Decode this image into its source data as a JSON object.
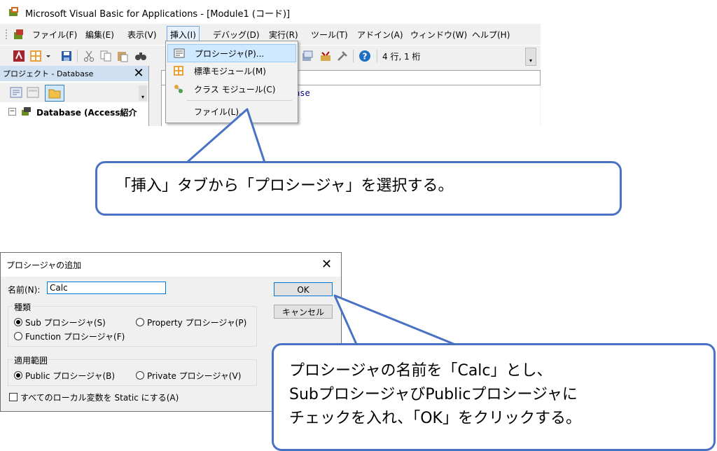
{
  "vba": {
    "title": "Microsoft Visual Basic for Applications - [Module1 (コード)]",
    "menus": [
      "ファイル(F)",
      "編集(E)",
      "表示(V)",
      "挿入(I)",
      "デバッグ(D)",
      "実行(R)",
      "ツール(T)",
      "アドイン(A)",
      "ウィンドウ(W)",
      "ヘルプ(H)"
    ],
    "active_menu": "挿入(I)",
    "position_status": "4 行, 1 桁",
    "project_title": "プロジェクト - Database",
    "project_close": "✕",
    "tree_root": "Database (Access紹介",
    "code_fragment": "ase"
  },
  "insert_menu": {
    "items": [
      {
        "label": "プロシージャ(P)...",
        "icon": "procedure-icon",
        "highlighted": true
      },
      {
        "label": "標準モジュール(M)",
        "icon": "module-icon"
      },
      {
        "label": "クラス モジュール(C)",
        "icon": "class-module-icon"
      },
      {
        "label": "ファイル(L)..."
      }
    ]
  },
  "callout1": {
    "text": "「挿入」タブから「プロシージャ」を選択する。"
  },
  "dialog": {
    "title": "プロシージャの追加",
    "close": "✕",
    "name_label": "名前(N):",
    "name_value": "Calc",
    "ok_label": "OK",
    "cancel_label": "キャンセル",
    "kind_group": "種類",
    "kind_sub": "Sub プロシージャ(S)",
    "kind_property": "Property プロシージャ(P)",
    "kind_function": "Function プロシージャ(F)",
    "scope_group": "適用範囲",
    "scope_public": "Public プロシージャ(B)",
    "scope_private": "Private プロシージャ(V)",
    "static_label": "すべてのローカル変数を Static にする(A)"
  },
  "callout2": {
    "lines": [
      "プロシージャの名前を「Calc」とし、",
      "SubプロシージャびPublicプロシージャに",
      "チェックを入れ、「OK」をクリックする。"
    ]
  },
  "colors": {
    "callout_border": "#4a72c4",
    "highlight": "#cde8ff"
  }
}
